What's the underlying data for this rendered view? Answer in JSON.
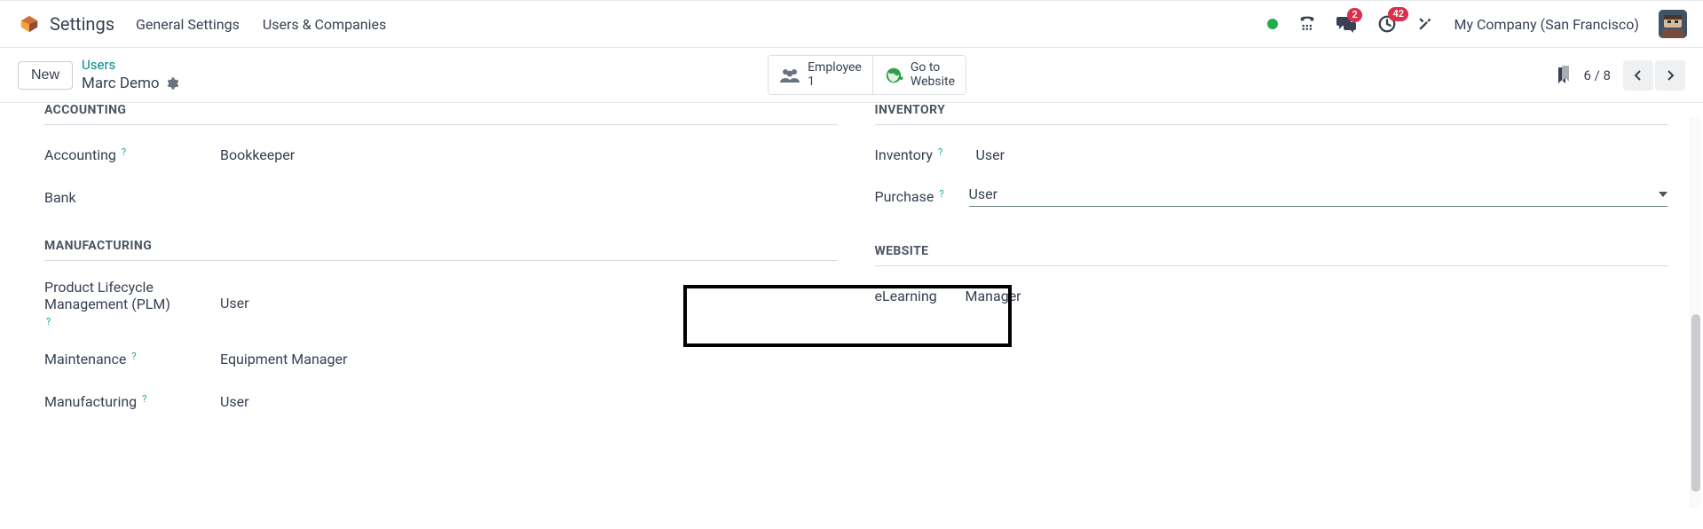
{
  "app_title": "Settings",
  "menu": {
    "general": "General Settings",
    "users": "Users & Companies"
  },
  "header": {
    "company": "My Company (San Francisco)",
    "messages_badge": "2",
    "activities_badge": "42"
  },
  "breadcrumb": {
    "new_label": "New",
    "parent": "Users",
    "current": "Marc Demo"
  },
  "stats": {
    "employee_line1": "Employee",
    "employee_line2": "1",
    "goto_line1": "Go to",
    "goto_line2": "Website"
  },
  "pager": {
    "counter": "6 / 8"
  },
  "sections": {
    "accounting": {
      "title": "ACCOUNTING",
      "fields": {
        "accounting": {
          "label": "Accounting",
          "value": "Bookkeeper"
        },
        "bank": {
          "label": "Bank",
          "value": ""
        }
      }
    },
    "inventory": {
      "title": "INVENTORY",
      "fields": {
        "inventory": {
          "label": "Inventory",
          "value": "User"
        },
        "purchase": {
          "label": "Purchase",
          "value": "User"
        }
      }
    },
    "manufacturing": {
      "title": "MANUFACTURING",
      "fields": {
        "plm": {
          "label": "Product Lifecycle Management (PLM)",
          "value": "User"
        },
        "maintenance": {
          "label": "Maintenance",
          "value": "Equipment Manager"
        },
        "manufacturing": {
          "label": "Manufacturing",
          "value": "User"
        }
      }
    },
    "website": {
      "title": "WEBSITE",
      "fields": {
        "elearning": {
          "label": "eLearning",
          "value": "Manager"
        }
      }
    }
  }
}
